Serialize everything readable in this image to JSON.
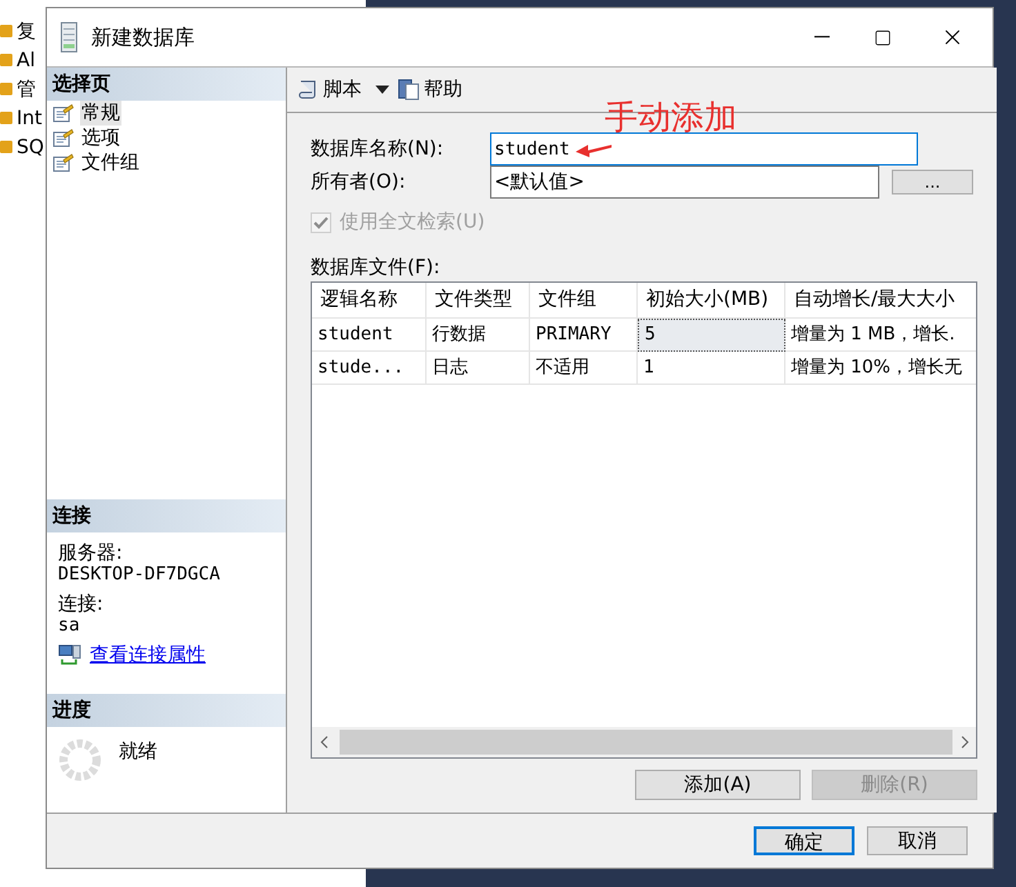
{
  "background_tree": [
    {
      "label": "复"
    },
    {
      "label": "Al"
    },
    {
      "label": "管"
    },
    {
      "label": "Int"
    },
    {
      "label": "SQ"
    }
  ],
  "window": {
    "title": "新建数据库"
  },
  "sidebar": {
    "header": "选择页",
    "items": [
      {
        "label": "常规",
        "selected": true
      },
      {
        "label": "选项",
        "selected": false
      },
      {
        "label": "文件组",
        "selected": false
      }
    ]
  },
  "connection": {
    "header": "连接",
    "server_label": "服务器:",
    "server": "DESKTOP-DF7DGCA",
    "connection_label": "连接:",
    "user": "sa",
    "link": "查看连接属性"
  },
  "progress": {
    "header": "进度",
    "status": "就绪"
  },
  "toolbar": {
    "script": "脚本",
    "help": "帮助"
  },
  "annotation": "手动添加",
  "form": {
    "name_label": "数据库名称(N):",
    "name_value": "student",
    "owner_label": "所有者(O):",
    "owner_value": "<默认值>",
    "browse_button": "...",
    "fulltext": {
      "label": "使用全文检索(U)",
      "checked": true,
      "disabled": true
    }
  },
  "files": {
    "label": "数据库文件(F):",
    "columns": [
      "逻辑名称",
      "文件类型",
      "文件组",
      "初始大小(MB)",
      "自动增长/最大大小"
    ],
    "rows": [
      {
        "cells": [
          {
            "text": "student",
            "selected": false
          },
          {
            "text": "行数据",
            "selected": false
          },
          {
            "text": "PRIMARY",
            "selected": false
          },
          {
            "text": "5",
            "selected": true
          },
          {
            "text": "增量为 1 MB，增长.",
            "selected": false
          }
        ]
      },
      {
        "cells": [
          {
            "text": "stude...",
            "selected": false
          },
          {
            "text": "日志",
            "selected": false
          },
          {
            "text": "不适用",
            "selected": false
          },
          {
            "text": "1",
            "selected": false
          },
          {
            "text": "增量为 10%，增长无",
            "selected": false
          }
        ]
      }
    ]
  },
  "file_buttons": [
    {
      "label": "添加(A)",
      "disabled": false
    },
    {
      "label": "删除(R)",
      "disabled": true
    }
  ],
  "footer_buttons": [
    {
      "label": "确定",
      "default": true
    },
    {
      "label": "取消",
      "default": false
    }
  ]
}
